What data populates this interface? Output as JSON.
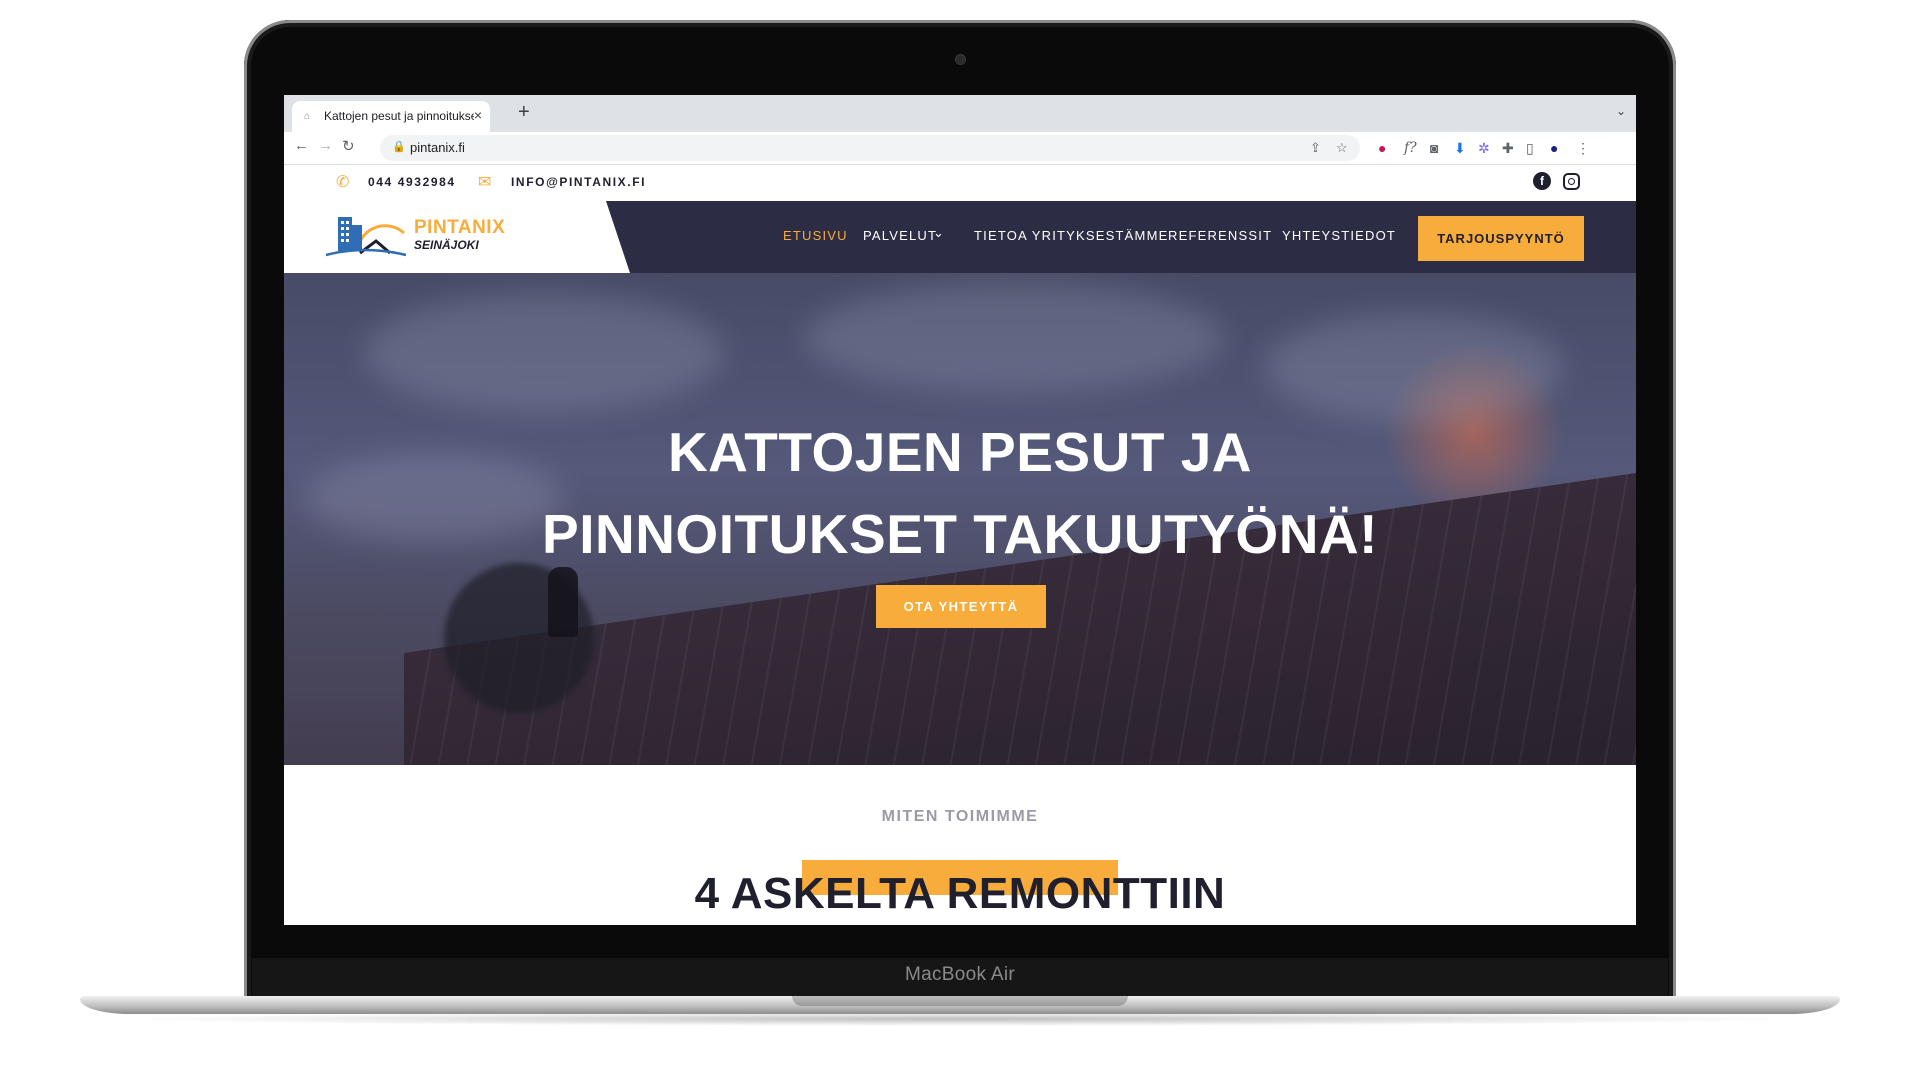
{
  "device": {
    "brand_label": "MacBook Air"
  },
  "browser": {
    "tab_title": "Kattojen pesut ja pinnoitukset",
    "tab_close": "×",
    "new_tab": "+",
    "tab_menu": "⌄",
    "url": "pintanix.fi",
    "nav_back": "←",
    "nav_forward": "→",
    "nav_reload": "↻"
  },
  "topbar": {
    "phone": "044 4932984",
    "email": "INFO@PINTANIX.FI",
    "social_facebook": "f"
  },
  "header": {
    "logo_name": "PINTANIX",
    "logo_city": "SEINÄJOKI",
    "nav": [
      "ETUSIVU",
      "PALVELUT",
      "TIETOA YRITYKSESTÄMME",
      "REFERENSSIT",
      "YHTEYSTIEDOT"
    ],
    "services_caret": "⌄",
    "cta_label": "TARJOUSPYYNTÖ"
  },
  "hero": {
    "title_line1": "KATTOJEN PESUT JA",
    "title_line2": "PINNOITUKSET TAKUUTYÖNÄ!",
    "button_label": "OTA YHTEYTTÄ"
  },
  "section": {
    "eyebrow": "MITEN TOIMIMME",
    "title": "4 ASKELTA REMONTTIIN"
  },
  "colors": {
    "accent": "#f8ac3b",
    "navy": "#2c2d45",
    "dark": "#1f1f2e"
  }
}
